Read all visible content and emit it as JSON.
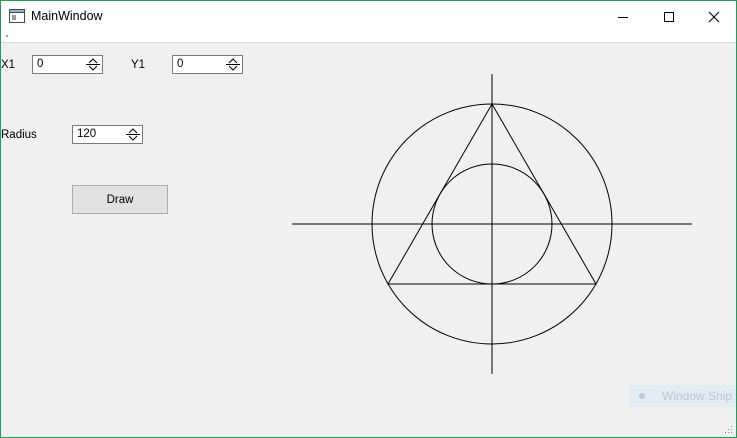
{
  "window": {
    "title": "MainWindow"
  },
  "icons": {
    "app": "app-window-icon",
    "minimize": "minimize-icon",
    "maximize": "maximize-icon",
    "close": "close-icon"
  },
  "form": {
    "x1_label": "X1",
    "x1_value": "0",
    "y1_label": "Y1",
    "y1_value": "0",
    "radius_label": "Radius",
    "radius_value": "120",
    "draw_label": "Draw"
  },
  "overlay": {
    "snip_label": "Window Snip"
  }
}
